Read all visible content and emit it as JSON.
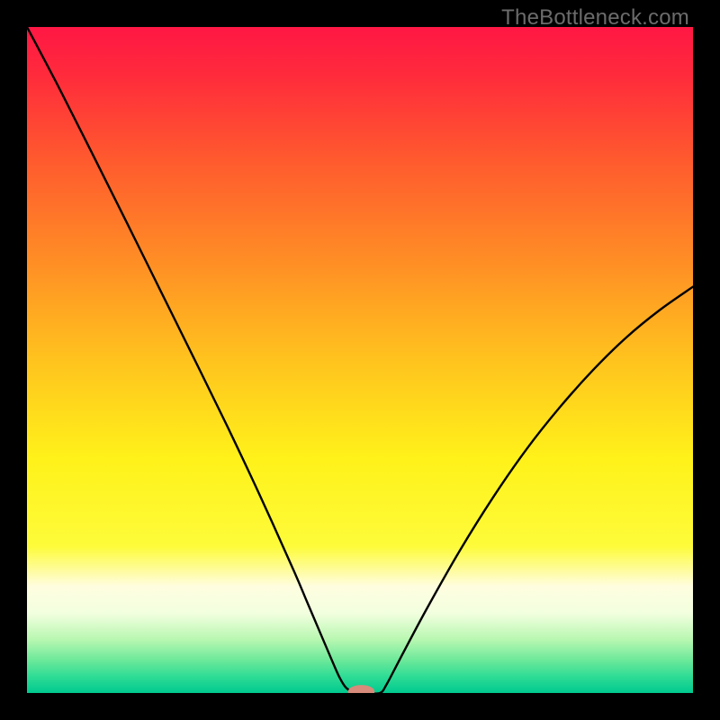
{
  "watermark": {
    "text": "TheBottleneck.com"
  },
  "chart_data": {
    "type": "line",
    "title": "",
    "xlabel": "",
    "ylabel": "",
    "xlim": [
      0,
      100
    ],
    "ylim": [
      0,
      100
    ],
    "grid": false,
    "legend": false,
    "gradient_stops": [
      {
        "offset": 0.0,
        "color": "#ff1744"
      },
      {
        "offset": 0.07,
        "color": "#ff2a3c"
      },
      {
        "offset": 0.2,
        "color": "#ff5a2e"
      },
      {
        "offset": 0.35,
        "color": "#ff8d25"
      },
      {
        "offset": 0.5,
        "color": "#ffc31e"
      },
      {
        "offset": 0.65,
        "color": "#fff21a"
      },
      {
        "offset": 0.78,
        "color": "#fdfb3a"
      },
      {
        "offset": 0.84,
        "color": "#fffde0"
      },
      {
        "offset": 0.88,
        "color": "#f2ffdf"
      },
      {
        "offset": 0.92,
        "color": "#b7f7b1"
      },
      {
        "offset": 0.95,
        "color": "#6ee99a"
      },
      {
        "offset": 0.975,
        "color": "#2fdc95"
      },
      {
        "offset": 1.0,
        "color": "#00c98f"
      }
    ],
    "series": [
      {
        "name": "bottleneck-curve",
        "color": "#000000",
        "width": 2.4,
        "x": [
          0,
          5,
          10,
          15,
          20,
          25,
          30,
          35,
          40,
          42,
          44,
          46,
          47,
          48,
          49.5,
          51,
          53,
          54,
          56,
          60,
          65,
          70,
          75,
          80,
          85,
          90,
          95,
          100
        ],
        "y": [
          100,
          90.5,
          80.6,
          70.6,
          60.5,
          50.4,
          40.2,
          29.6,
          18.5,
          13.8,
          9.1,
          4.4,
          2.2,
          0.7,
          0.0,
          0.0,
          0.0,
          1.3,
          5.1,
          12.6,
          21.4,
          29.4,
          36.6,
          42.9,
          48.5,
          53.4,
          57.5,
          61.0
        ]
      }
    ],
    "marker": {
      "x": 50.2,
      "y": 0.2,
      "color": "#d78b7a",
      "rx": 2.0,
      "ry": 1.0
    }
  }
}
